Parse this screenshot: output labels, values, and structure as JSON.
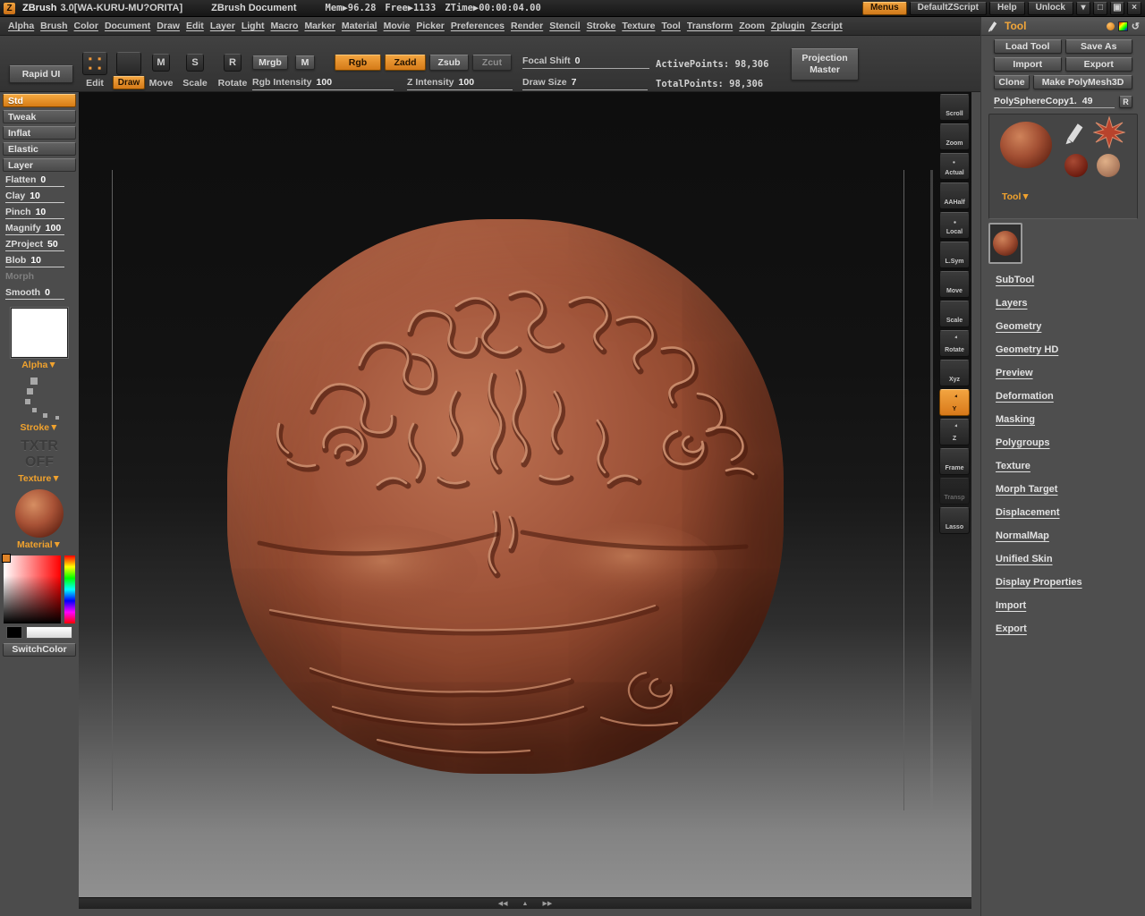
{
  "icons": {
    "logo": "Z",
    "win_min": "▾",
    "win_max": "□",
    "win_restore": "▣",
    "win_close": "×",
    "scroll_left": "◀◀",
    "scroll_up": "▲",
    "scroll_right": "▶▶",
    "reset": "↺",
    "move_letter": "M",
    "scale_letter": "S",
    "rotate_letter": "R"
  },
  "titlebar": {
    "app": "ZBrush",
    "version": "3.0[WA-KURU-MU?ORITA]",
    "document": "ZBrush Document",
    "mem": "Mem▶96.28",
    "free": "Free▶1133",
    "ztime": "ZTime▶00:00:04.00",
    "menus": "Menus",
    "default_zscript": "DefaultZScript",
    "help": "Help",
    "unlock": "Unlock"
  },
  "menubar": {
    "items": [
      "Alpha",
      "Brush",
      "Color",
      "Document",
      "Draw",
      "Edit",
      "Layer",
      "Light",
      "Macro",
      "Marker",
      "Material",
      "Movie",
      "Picker",
      "Preferences",
      "Render",
      "Stencil",
      "Stroke",
      "Texture",
      "Tool",
      "Transform",
      "Zoom",
      "Zplugin",
      "Zscript"
    ]
  },
  "shelf": {
    "rapid_ui": "Rapid UI",
    "edit": "Edit",
    "draw": "Draw",
    "move": "Move",
    "scale": "Scale",
    "rotate": "Rotate",
    "mrgb": "Mrgb",
    "m": "M",
    "rgb": "Rgb",
    "zadd": "Zadd",
    "zsub": "Zsub",
    "zcut": "Zcut",
    "focal_shift_label": "Focal Shift",
    "focal_shift_value": "0",
    "rgb_intensity_label": "Rgb Intensity",
    "rgb_intensity_value": "100",
    "z_intensity_label": "Z Intensity",
    "z_intensity_value": "100",
    "draw_size_label": "Draw Size",
    "draw_size_value": "7",
    "active_points": "ActivePoints: 98,306",
    "total_points": "TotalPoints: 98,306",
    "projection_master_line1": "Projection",
    "projection_master_line2": "Master"
  },
  "left_sidebar": {
    "items": [
      {
        "label": "Std"
      },
      {
        "label": "Tweak"
      },
      {
        "label": "Inflat"
      },
      {
        "label": "Elastic"
      },
      {
        "label": "Layer"
      },
      {
        "label": "Flatten",
        "value": "0"
      },
      {
        "label": "Clay",
        "value": "10"
      },
      {
        "label": "Pinch",
        "value": "10"
      },
      {
        "label": "Magnify",
        "value": "100"
      },
      {
        "label": "ZProject",
        "value": "50"
      },
      {
        "label": "Blob",
        "value": "10"
      },
      {
        "label": "Morph"
      },
      {
        "label": "Smooth",
        "value": "0"
      }
    ],
    "alpha_label": "Alpha▼",
    "stroke_label": "Stroke▼",
    "txtr_line1": "TXTR",
    "txtr_line2": "OFF",
    "texture_label": "Texture▼",
    "material_label": "Material▼",
    "switch_color": "SwitchColor"
  },
  "tray": {
    "items": [
      {
        "label": "Scroll"
      },
      {
        "label": "Zoom"
      },
      {
        "label": "Actual"
      },
      {
        "label": "AAHalf"
      },
      {
        "label": "Local"
      },
      {
        "label": "L.Sym"
      },
      {
        "label": "Move"
      },
      {
        "label": "Scale"
      },
      {
        "label": "Rotate"
      },
      {
        "label": "Xyz"
      },
      {
        "label": "Y"
      },
      {
        "label": "Z"
      },
      {
        "label": "Frame"
      },
      {
        "label": "Transp"
      },
      {
        "label": "Lasso"
      }
    ]
  },
  "tool_panel": {
    "title": "Tool",
    "load_tool": "Load Tool",
    "save_as": "Save As",
    "import": "Import",
    "export": "Export",
    "clone": "Clone",
    "make_polymesh3d": "Make PolyMesh3D",
    "current_tool_name": "PolySphereCopy1.",
    "current_tool_value": "49",
    "r_button": "R",
    "tool_dropdown": "Tool▼",
    "sections": [
      "SubTool",
      "Layers",
      "Geometry",
      "Geometry HD",
      "Preview",
      "Deformation",
      "Masking",
      "Polygroups",
      "Texture",
      "Morph Target",
      "Displacement",
      "NormalMap",
      "Unified Skin",
      "Display Properties",
      "Import",
      "Export"
    ]
  },
  "colors": {
    "accent_orange": "#e0872c",
    "sphere_base": "#9a4c36",
    "ui_gray": "#4c4c4c"
  }
}
